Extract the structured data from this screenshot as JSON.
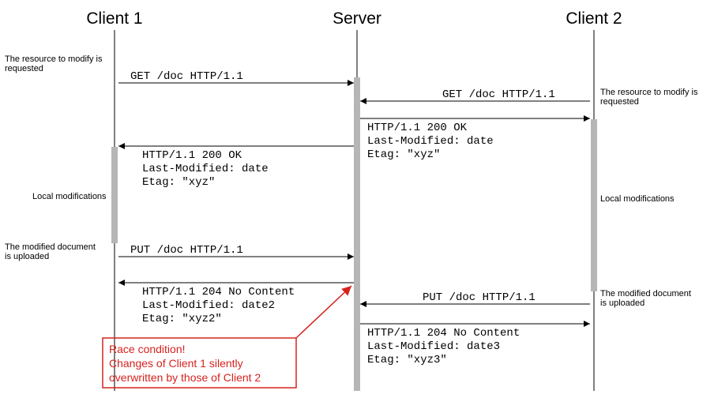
{
  "actors": {
    "client1": "Client 1",
    "server": "Server",
    "client2": "Client 2"
  },
  "left": {
    "note_request": "The resource to modify is\nrequested",
    "note_local": "Local modifications",
    "note_upload": "The modified document\nis uploaded"
  },
  "right": {
    "note_request": "The resource to modify is\nrequested",
    "note_local": "Local modifications",
    "note_upload": "The modified document\nis uploaded"
  },
  "msgs": {
    "c1_get": "GET /doc HTTP/1.1",
    "c2_get": "GET /doc HTTP/1.1",
    "c1_resp_l1": "HTTP/1.1 200 OK",
    "c1_resp_l2": "Last-Modified: date",
    "c1_resp_l3": "Etag: \"xyz\"",
    "c2_resp_l1": "HTTP/1.1 200 OK",
    "c2_resp_l2": "Last-Modified: date",
    "c2_resp_l3": "Etag: \"xyz\"",
    "c1_put": "PUT /doc HTTP/1.1",
    "c1_put_r1": "HTTP/1.1 204 No Content",
    "c1_put_r2": "Last-Modified: date2",
    "c1_put_r3": "Etag: \"xyz2\"",
    "c2_put": "PUT /doc HTTP/1.1",
    "c2_put_r1": "HTTP/1.1 204 No Content",
    "c2_put_r2": "Last-Modified: date3",
    "c2_put_r3": "Etag: \"xyz3\""
  },
  "callout": {
    "l1": "Race condition!",
    "l2": "Changes of Client 1 silently",
    "l3": "overwritten by those of Client 2"
  }
}
